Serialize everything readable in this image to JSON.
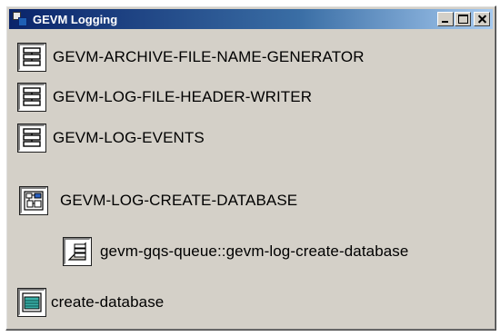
{
  "window": {
    "title": "GEVM Logging"
  },
  "items": [
    {
      "label": "GEVM-ARCHIVE-FILE-NAME-GENERATOR",
      "icon": "procedure-icon"
    },
    {
      "label": "GEVM-LOG-FILE-HEADER-WRITER",
      "icon": "procedure-icon"
    },
    {
      "label": "GEVM-LOG-EVENTS",
      "icon": "procedure-icon"
    },
    {
      "label": "GEVM-LOG-CREATE-DATABASE",
      "icon": "workspace-icon"
    },
    {
      "label": "gevm-gqs-queue::gevm-log-create-database",
      "icon": "method-icon"
    },
    {
      "label": "create-database",
      "icon": "database-icon"
    }
  ],
  "colors": {
    "titlebar_start": "#0a246a",
    "titlebar_end": "#a6caf0",
    "window_bg": "#d4d0c8",
    "database_fill": "#3ab0a8"
  }
}
